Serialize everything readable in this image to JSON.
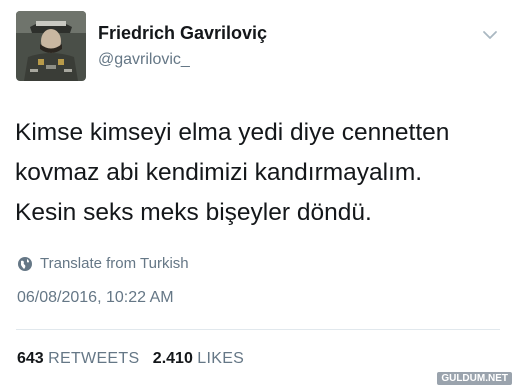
{
  "user": {
    "display_name": "Friedrich Gavriloviç",
    "handle": "@gavrilovic_",
    "avatar": "military-portrait-avatar"
  },
  "tweet": {
    "lines": [
      "Kimse kimseyi elma yedi diye cennetten",
      "kovmaz abi kendimizi kandırmayalım.",
      "Kesin seks meks bişeyler döndü."
    ],
    "translate_label": "Translate from Turkish",
    "timestamp": "06/08/2016, 10:22 AM"
  },
  "stats": {
    "retweets_count": "643",
    "retweets_label": "RETWEETS",
    "likes_count": "2.410",
    "likes_label": "LIKES"
  },
  "icons": {
    "menu": "chevron-down-icon",
    "translate": "globe-icon"
  },
  "watermark": "GULDUM.NET",
  "colors": {
    "text_primary": "#14171a",
    "text_secondary": "#657786",
    "divider": "#e1e8ed"
  }
}
